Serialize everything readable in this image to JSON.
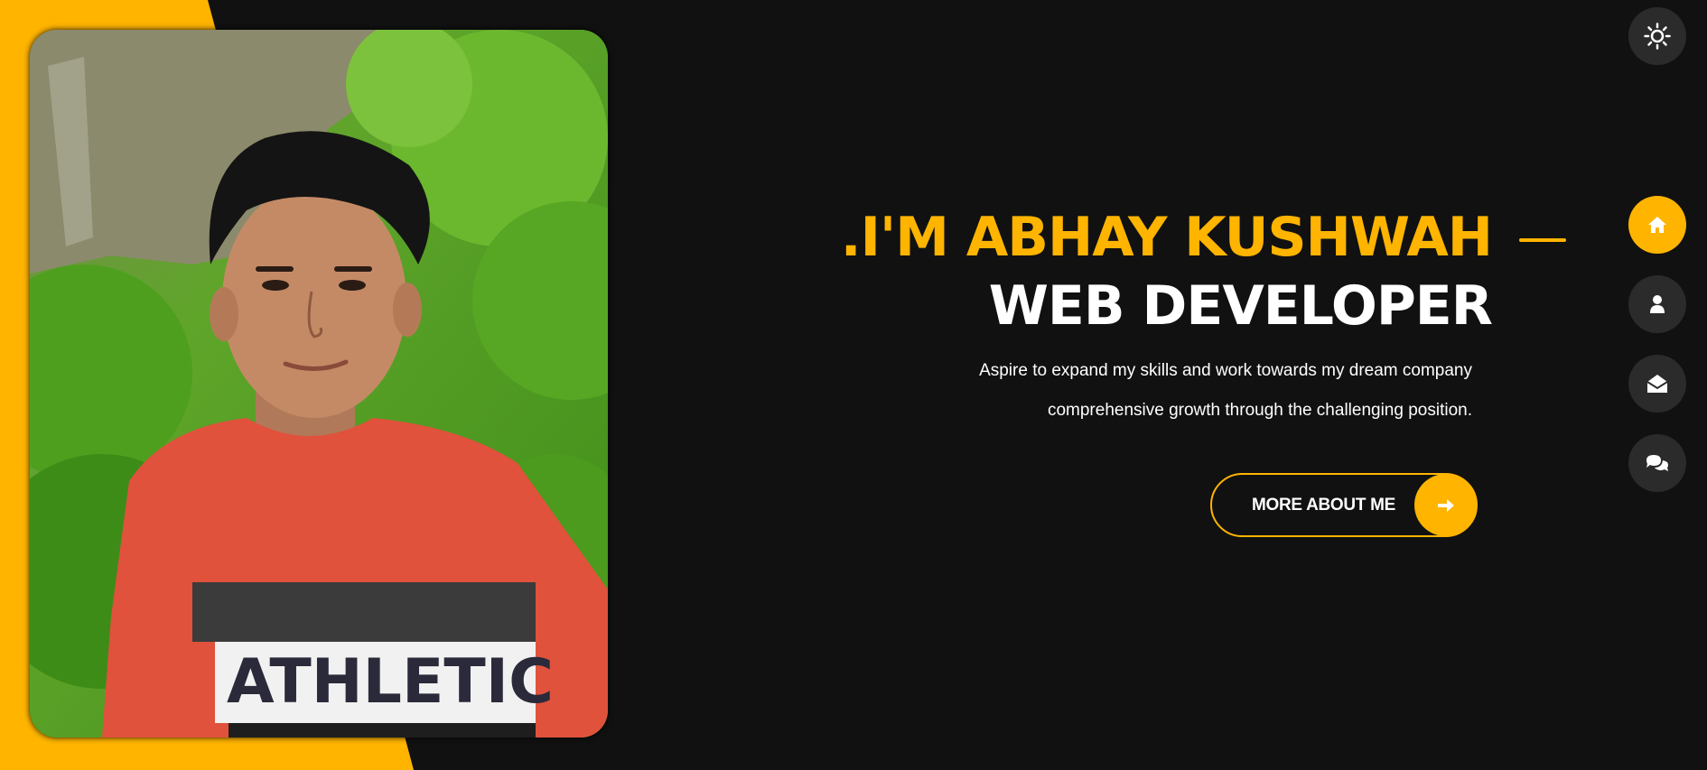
{
  "hero": {
    "title": ".I'M ABHAY KUSHWAH",
    "subtitle": "WEB DEVELOPER",
    "description_line1": "Aspire to expand my skills and work towards my dream company",
    "description_line2": "comprehensive growth through the challenging position.",
    "cta_label": "MORE ABOUT ME",
    "cta_icon": "arrow-right-icon"
  },
  "photo": {
    "alt": "Profile photo",
    "shirt_text": "ATHLETIC"
  },
  "theme_toggle": {
    "icon": "sun-icon"
  },
  "side_nav": [
    {
      "name": "home",
      "icon": "home-icon",
      "active": true
    },
    {
      "name": "about",
      "icon": "user-icon",
      "active": false
    },
    {
      "name": "portfolio",
      "icon": "envelope-open-icon",
      "active": false
    },
    {
      "name": "contact",
      "icon": "comments-icon",
      "active": false
    }
  ],
  "colors": {
    "accent": "#ffb400",
    "background": "#111111",
    "nav_bg": "#2b2b2b",
    "text": "#ffffff"
  }
}
